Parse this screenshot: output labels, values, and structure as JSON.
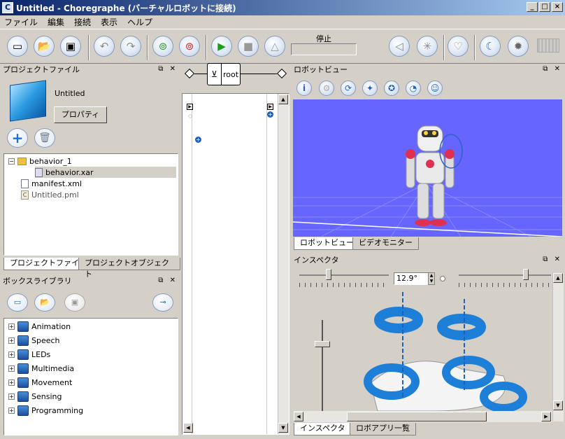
{
  "window": {
    "title": "Untitled - Choregraphe (バーチャルロボットに接続)",
    "app_icon": "C",
    "min": "_",
    "max": "□",
    "close": "×"
  },
  "menu": [
    "ファイル",
    "編集",
    "接続",
    "表示",
    "ヘルプ"
  ],
  "toolbar": {
    "status_label": "停止"
  },
  "project": {
    "header": "プロジェクトファイル",
    "name": "Untitled",
    "properties_button": "プロパティ",
    "tree": [
      {
        "label": "behavior_1"
      },
      {
        "label": "behavior.xar"
      },
      {
        "label": "manifest.xml"
      },
      {
        "label": "Untitled.pml"
      }
    ],
    "tabs": [
      "プロジェクトファイル",
      "プロジェクトオブジェクト"
    ]
  },
  "boxlib": {
    "header": "ボックスライブラリ",
    "items": [
      "Animation",
      "Speech",
      "LEDs",
      "Multimedia",
      "Movement",
      "Sensing",
      "Programming"
    ]
  },
  "flow": {
    "root_label": "root"
  },
  "robotview": {
    "header": "ロボットビュー",
    "tabs": [
      "ロボットビュー",
      "ビデオモニター"
    ]
  },
  "inspector": {
    "header": "インスペクタ",
    "angle_value": "12.9°",
    "tabs": [
      "インスペクタ",
      "ロボアプリ一覧"
    ]
  },
  "colors": {
    "title_start": "#0a246a",
    "title_end": "#a6caf0",
    "viewport": "#6666ff",
    "accent_blue": "#1e7fd8"
  }
}
